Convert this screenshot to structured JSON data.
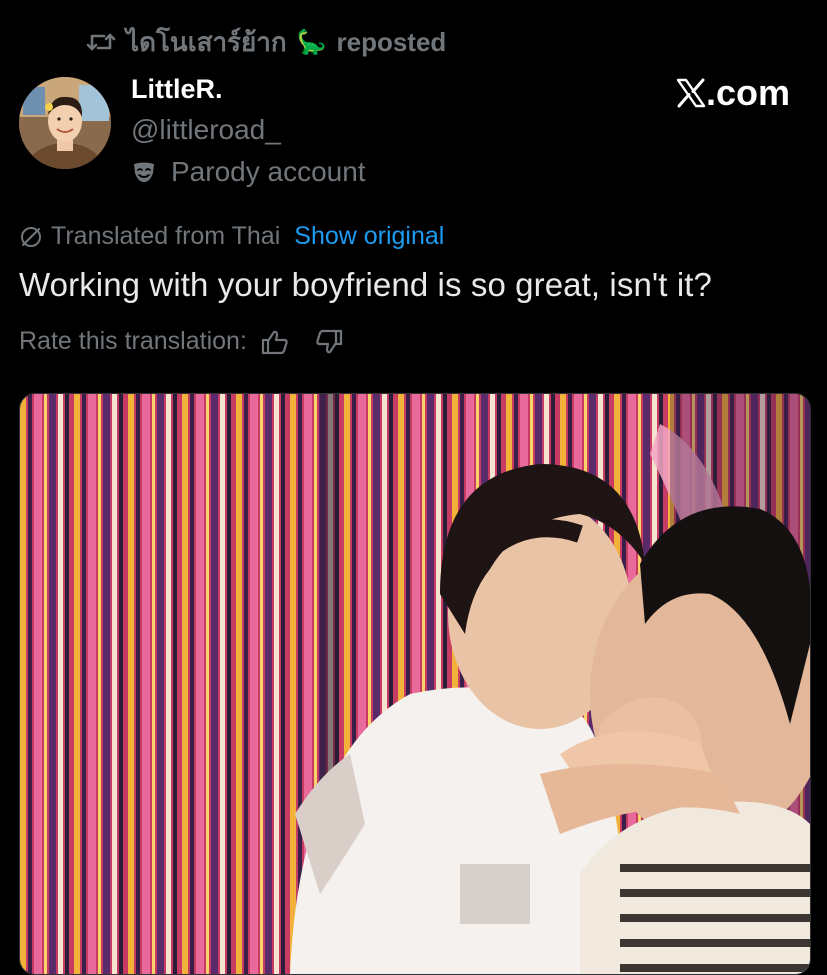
{
  "repost": {
    "icon": "repost-icon",
    "reposter_name": "ไดโนเสาร์ย้าก",
    "reposter_emoji": "🦕",
    "label": "reposted"
  },
  "author": {
    "display_name": "LittleR.",
    "handle": "@littleroad_",
    "parody_icon": "mask-icon",
    "parody_label": "Parody account"
  },
  "watermark": {
    "logo": "x-logo",
    "text": ".com"
  },
  "translation": {
    "icon": "globe-slash-icon",
    "label": "Translated from Thai",
    "show_original": "Show original",
    "rate_label": "Rate this translation:",
    "thumbs_up_icon": "thumbs-up-icon",
    "thumbs_down_icon": "thumbs-down-icon"
  },
  "tweet": {
    "text": "Working with your boyfriend is so great, isn't it?"
  },
  "colors": {
    "background": "#000000",
    "primary_text": "#e7e9ea",
    "secondary_text": "#71767b",
    "link": "#1d9bf0"
  }
}
